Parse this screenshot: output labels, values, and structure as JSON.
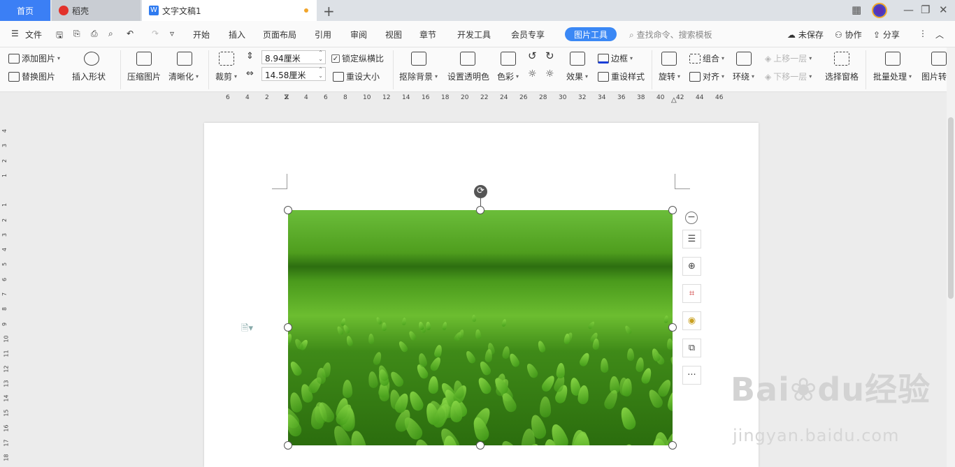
{
  "tabs": {
    "home": "首页",
    "daoke": "稻壳",
    "doc": "文字文稿1"
  },
  "menubar": {
    "file": "文件",
    "items": [
      "开始",
      "插入",
      "页面布局",
      "引用",
      "审阅",
      "视图",
      "章节",
      "开发工具",
      "会员专享"
    ],
    "active": "图片工具",
    "search": "查找命令、搜索模板",
    "unsaved": "未保存",
    "collab": "协作",
    "share": "分享"
  },
  "ribbon": {
    "add_picture": "添加图片",
    "replace_picture": "替换图片",
    "insert_shape": "插入形状",
    "compress": "压缩图片",
    "sharpen": "清晰化",
    "crop": "裁剪",
    "height": "8.94厘米",
    "width": "14.58厘米",
    "lock_ratio": "锁定纵横比",
    "reset_size": "重设大小",
    "remove_bg": "抠除背景",
    "transparent": "设置透明色",
    "color": "色彩",
    "effect": "效果",
    "border": "边框",
    "reset_style": "重设样式",
    "rotate": "旋转",
    "group": "组合",
    "align": "对齐",
    "wrap": "环绕",
    "bring_forward": "上移一层",
    "send_backward": "下移一层",
    "selection_pane": "选择窗格",
    "batch": "批量处理",
    "picture_convert": "图片转"
  },
  "ruler_top": [
    "6",
    "4",
    "2",
    "2",
    "4",
    "6",
    "8",
    "10",
    "12",
    "14",
    "16",
    "18",
    "20",
    "22",
    "24",
    "26",
    "28",
    "30",
    "32",
    "34",
    "36",
    "38",
    "40",
    "42",
    "44",
    "46"
  ],
  "ruler_left": [
    "4",
    "3",
    "2",
    "1",
    "1",
    "2",
    "3",
    "4",
    "5",
    "6",
    "7",
    "8",
    "9",
    "10",
    "11",
    "12",
    "13",
    "14",
    "15",
    "16",
    "17",
    "18"
  ],
  "floating_toolbar": {
    "more": "···"
  },
  "watermark": {
    "brand": "Bai",
    "brand2": "du",
    "suffix": "经验",
    "url": "jingyan.baidu.com"
  }
}
